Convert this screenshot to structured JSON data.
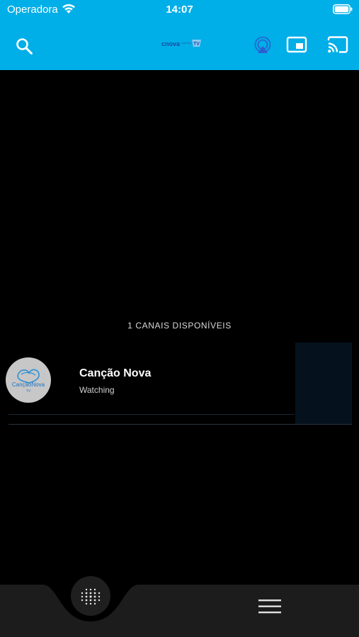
{
  "status_bar": {
    "carrier": "Operadora",
    "time": "14:07",
    "wifi_icon": "wifi-icon",
    "battery_icon": "battery-icon"
  },
  "toolbar": {
    "search_icon": "search-icon",
    "logo_text": "TV",
    "airplay_icon": "airplay-icon",
    "pip_icon": "picture-in-picture-icon",
    "cast_icon": "cast-icon"
  },
  "channels": {
    "count_label": "1 CANAIS DISPONÍVEIS",
    "items": [
      {
        "name": "Canção Nova",
        "status": "Watching",
        "logo_text": "CançãoNova",
        "logo_subtext": "TV"
      }
    ]
  },
  "bottom_bar": {
    "center_icon": "dots-grid-icon",
    "menu_icon": "hamburger-menu-icon"
  },
  "colors": {
    "header": "#00aee8",
    "background": "#000000",
    "bottom_bar": "#1c1c1c"
  }
}
